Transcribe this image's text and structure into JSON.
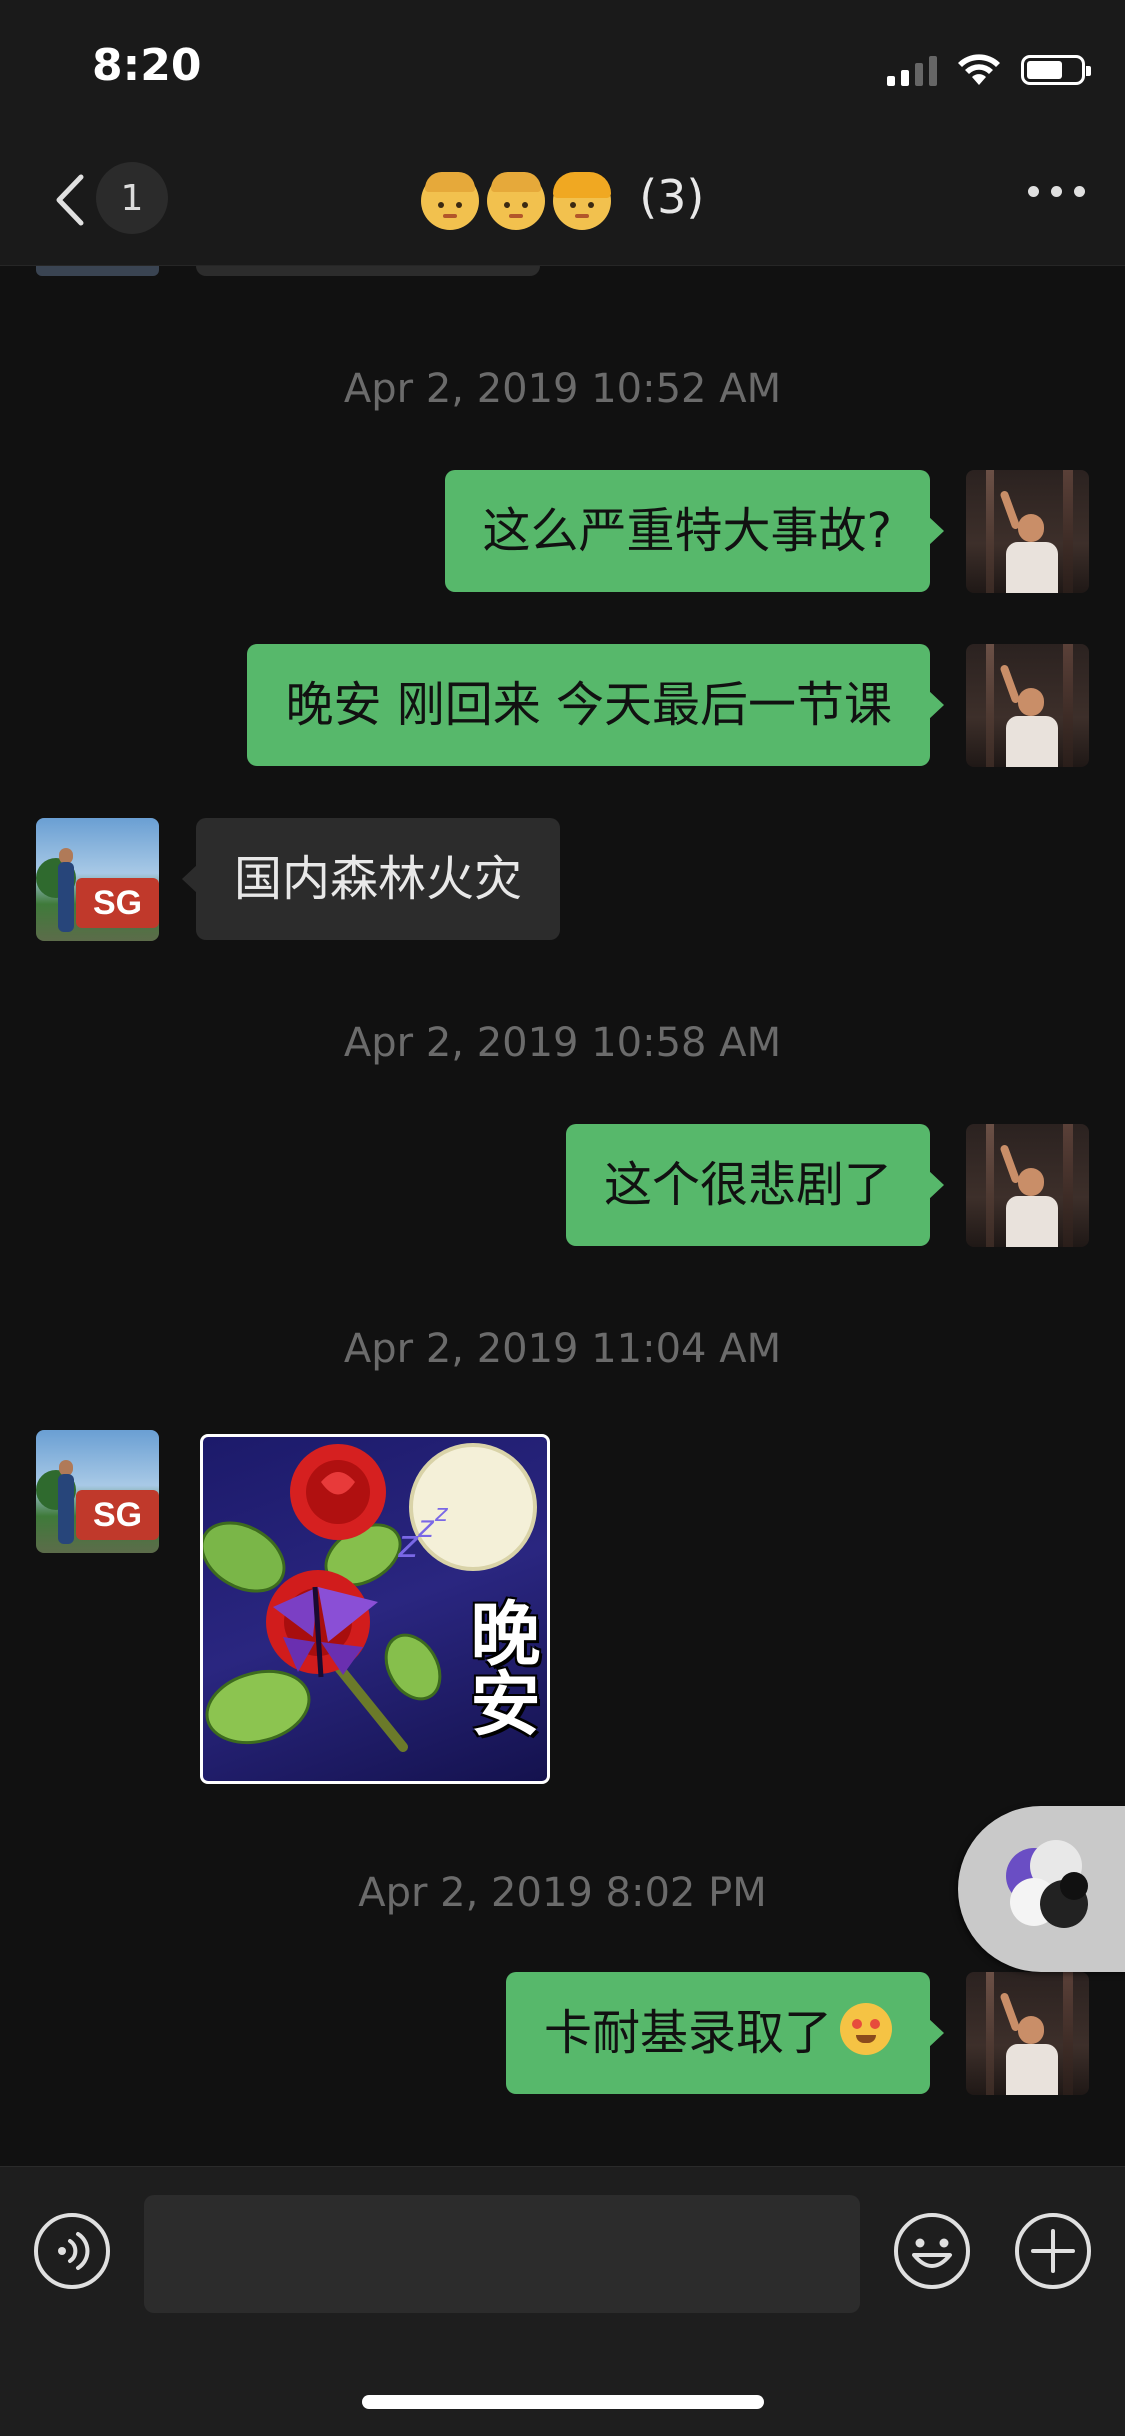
{
  "status_bar": {
    "time": "8:20",
    "icons": [
      "cellular-signal-icon",
      "wifi-icon",
      "battery-icon"
    ]
  },
  "nav": {
    "back_icon": "chevron-left-icon",
    "unread_count": "1",
    "title_emojis": [
      "man-face-emoji",
      "boy-face-emoji",
      "woman-face-emoji"
    ],
    "title_count": "(3)",
    "more_icon": "more-dots-icon"
  },
  "messages": [
    {
      "type": "timestamp",
      "text": "Apr 2, 2019 10:52 AM"
    },
    {
      "type": "text",
      "sender": "me",
      "text": "这么严重特大事故?"
    },
    {
      "type": "text",
      "sender": "me",
      "text": "晚安 刚回来 今天最后一节课"
    },
    {
      "type": "text",
      "sender": "other",
      "text": "国内森林火灾"
    },
    {
      "type": "timestamp",
      "text": "Apr 2, 2019 10:58 AM"
    },
    {
      "type": "text",
      "sender": "me",
      "text": "这个很悲剧了"
    },
    {
      "type": "timestamp",
      "text": "Apr 2, 2019 11:04 AM"
    },
    {
      "type": "sticker",
      "sender": "other",
      "text": "晚安",
      "description_icon": "rose-butterfly-moon-sticker"
    },
    {
      "type": "timestamp",
      "text": "Apr 2, 2019 8:02 PM"
    },
    {
      "type": "text",
      "sender": "me",
      "text": "卡耐基录取了",
      "trailing_emoji": "heart-eyes-emoji"
    }
  ],
  "input_bar": {
    "voice_icon": "voice-input-icon",
    "text_value": "",
    "emoji_icon": "smiley-icon",
    "plus_icon": "plus-circle-icon"
  },
  "floating_button_icon": "floating-window-icon",
  "colors": {
    "background": "#111111",
    "bar": "#1a1a1a",
    "my_bubble": "#57b86b",
    "other_bubble": "#2c2c2c",
    "timestamp": "#6b6b6b"
  }
}
